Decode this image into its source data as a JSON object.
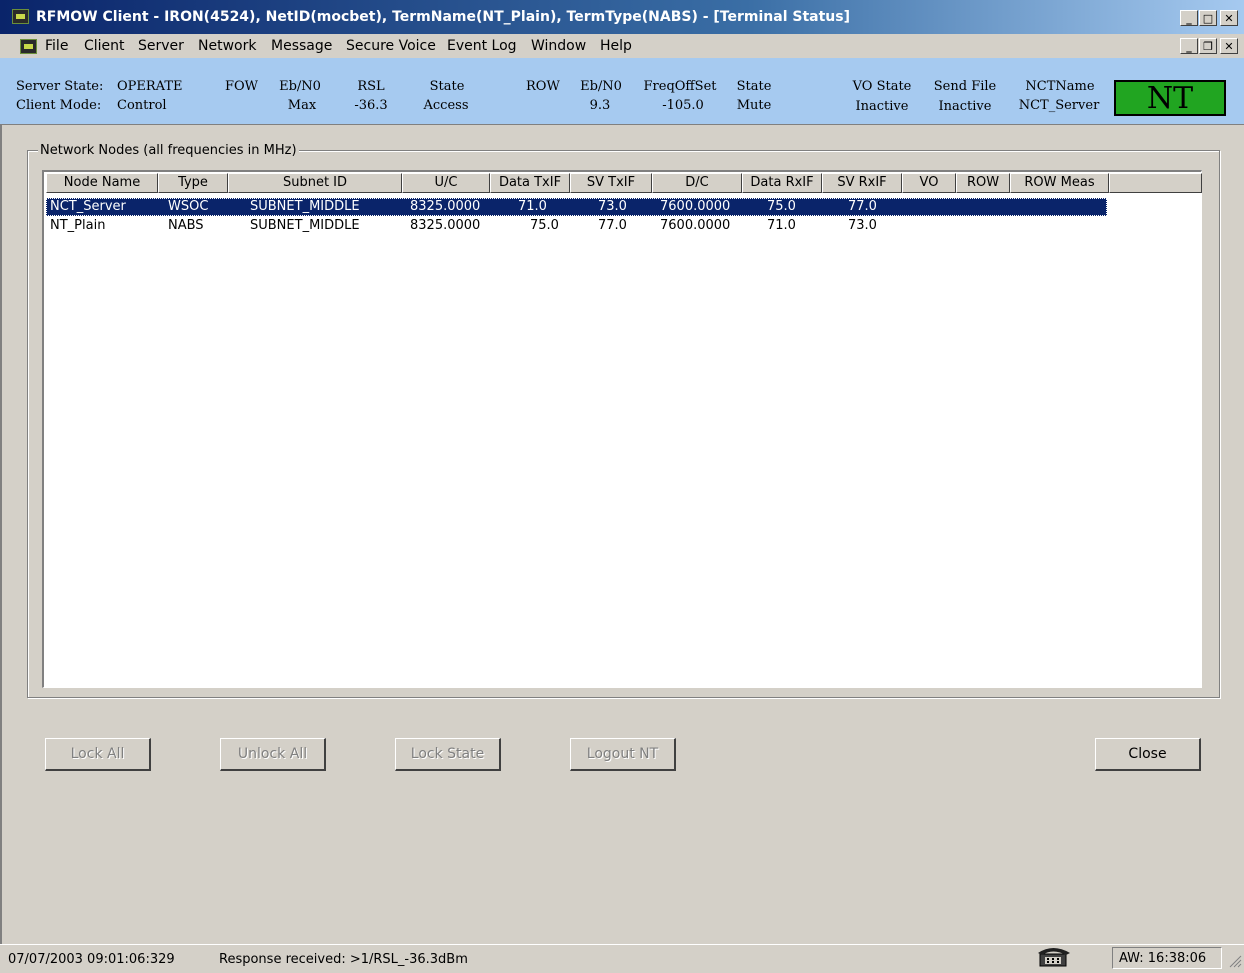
{
  "window": {
    "title": "RFMOW Client - IRON(4524), NetID(mocbet), TermName(NT_Plain), TermType(NABS) - [Terminal Status]",
    "title_buttons": [
      "_",
      "□",
      "X"
    ],
    "mdi_buttons": [
      "_",
      "🗗",
      "X"
    ]
  },
  "menu": [
    "File",
    "Client",
    "Server",
    "Network",
    "Message",
    "Secure Voice",
    "Event Log",
    "Window",
    "Help"
  ],
  "status_header": {
    "server_state_label": "Server State:",
    "server_state": "OPERATE",
    "client_mode_label": "Client Mode:",
    "client_mode": "Control",
    "fow_label": "FOW",
    "fow_ebno_label": "Eb/N0",
    "fow_ebno": "Max",
    "rsl_label": "RSL",
    "rsl": "-36.3",
    "fow_state_label": "State",
    "fow_state": "Access",
    "row_label": "ROW",
    "row_ebno_label": "Eb/N0",
    "row_ebno": "9.3",
    "freq_offset_label": "FreqOffSet",
    "freq_offset": "-105.0",
    "row_state_label": "State",
    "row_state": "Mute",
    "vo_state_label": "VO State",
    "vo_state": "Inactive",
    "send_file_label": "Send File",
    "send_file": "Inactive",
    "nct_name_label": "NCTName",
    "nct_name": "NCT_Server",
    "nt_indicator": "NT",
    "nt_indicator_color": "#21a521"
  },
  "network_nodes": {
    "group_label": "Network Nodes (all frequencies in MHz)",
    "columns": [
      "Node Name",
      "Type",
      "Subnet ID",
      "U/C",
      "Data TxIF",
      "SV TxIF",
      "D/C",
      "Data RxIF",
      "SV RxIF",
      "VO",
      "ROW",
      "ROW Meas"
    ],
    "rows": [
      {
        "node_name": "NCT_Server",
        "type": "WSOC",
        "subnet_id": "SUBNET_MIDDLE",
        "uc": "8325.0000",
        "data_txif": "71.0",
        "sv_txif": "73.0",
        "dc": "7600.0000",
        "data_rxif": "75.0",
        "sv_rxif": "77.0",
        "vo": "",
        "row": "",
        "row_meas": "",
        "selected": true
      },
      {
        "node_name": "NT_Plain",
        "type": "NABS",
        "subnet_id": "SUBNET_MIDDLE",
        "uc": "8325.0000",
        "data_txif": "75.0",
        "sv_txif": "77.0",
        "dc": "7600.0000",
        "data_rxif": "71.0",
        "sv_rxif": "73.0",
        "vo": "",
        "row": "",
        "row_meas": "",
        "selected": false
      }
    ]
  },
  "buttons": {
    "lock_all": "Lock All",
    "unlock_all": "Unlock All",
    "lock_state": "Lock State",
    "logout_nt": "Logout NT",
    "close": "Close"
  },
  "statusbar": {
    "timestamp": "07/07/2003 09:01:06:329",
    "message": "Response received: >1/RSL_-36.3dBm",
    "aw_time": "AW: 16:38:06"
  },
  "colors": {
    "title_gradient_start": "#0a246a",
    "header_bg": "#a6caf0",
    "selection": "#0a246a",
    "face": "#d4d0c8"
  }
}
